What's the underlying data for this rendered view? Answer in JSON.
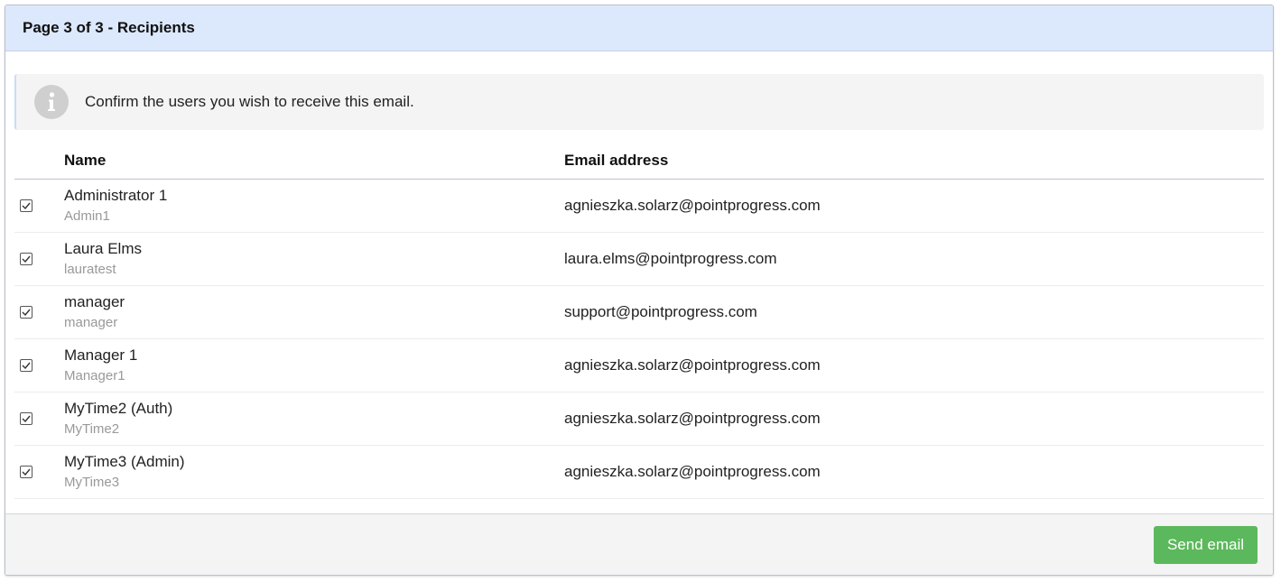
{
  "header": {
    "title": "Page 3 of 3 - Recipients"
  },
  "alert": {
    "icon": "info-icon",
    "text": "Confirm the users you wish to receive this email."
  },
  "table": {
    "columns": {
      "name": "Name",
      "email": "Email address"
    },
    "rows": [
      {
        "checked": true,
        "name": "Administrator 1",
        "username": "Admin1",
        "email": "agnieszka.solarz@pointprogress.com"
      },
      {
        "checked": true,
        "name": "Laura Elms",
        "username": "lauratest",
        "email": "laura.elms@pointprogress.com"
      },
      {
        "checked": true,
        "name": "manager",
        "username": "manager",
        "email": "support@pointprogress.com"
      },
      {
        "checked": true,
        "name": "Manager 1",
        "username": "Manager1",
        "email": "agnieszka.solarz@pointprogress.com"
      },
      {
        "checked": true,
        "name": "MyTime2 (Auth)",
        "username": "MyTime2",
        "email": "agnieszka.solarz@pointprogress.com"
      },
      {
        "checked": true,
        "name": "MyTime3 (Admin)",
        "username": "MyTime3",
        "email": "agnieszka.solarz@pointprogress.com"
      }
    ]
  },
  "footer": {
    "send_label": "Send email"
  },
  "colors": {
    "header_bg": "#dce8fb",
    "button_bg": "#5cb85c",
    "alert_bg": "#f4f4f4",
    "muted_text": "#999999"
  }
}
